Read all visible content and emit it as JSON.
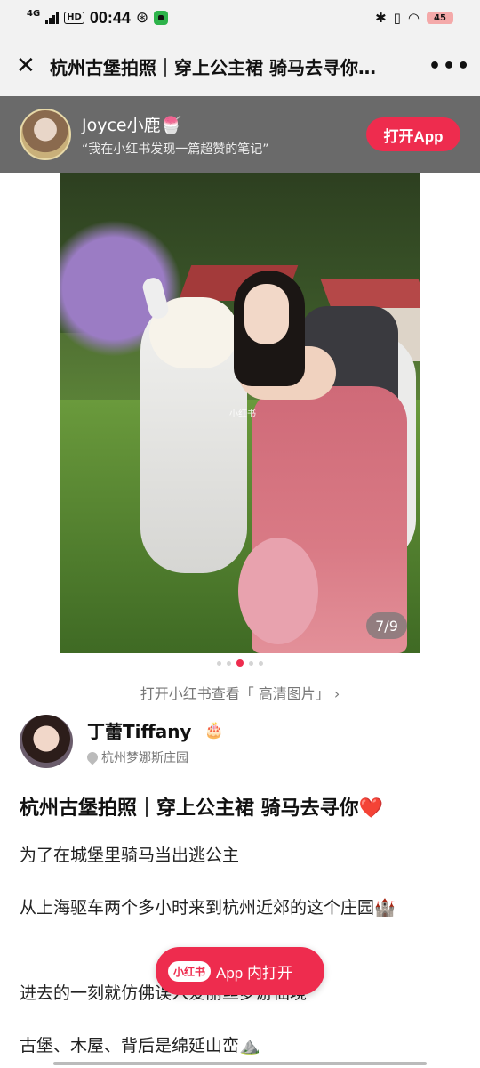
{
  "status_bar": {
    "network": "4G",
    "hd": "HD",
    "time": "00:44",
    "battery": "45"
  },
  "header": {
    "title": "杭州古堡拍照｜穿上公主裙 骑马去寻你…",
    "close_icon": "close-icon",
    "more": "•••"
  },
  "share_banner": {
    "sharer_name": "Joyce小鹿🍧",
    "quote": "“我在小红书发现一篇超赞的笔记”",
    "open_app_label": "打开App"
  },
  "photo": {
    "watermark": "小红书",
    "page_counter": "7/9",
    "current_index": 3,
    "total_dots": 5
  },
  "hd_link": "打开小红书查看「 高清图片」 ›",
  "author": {
    "name": "丁蕾Tiffany",
    "badge": "🎂",
    "location": "杭州梦娜斯庄园"
  },
  "note": {
    "title": "杭州古堡拍照｜穿上公主裙 骑马去寻你",
    "title_emoji": "❤️",
    "paragraphs": [
      "为了在城堡里骑马当出逃公主",
      "从上海驱车两个多小时来到杭州近郊的这个庄园🏰",
      "进去的一刻就仿佛误入爱丽丝梦游仙境",
      "古堡、木屋、背后是绵延山峦⛰️"
    ]
  },
  "floating_button": {
    "logo": "小红书",
    "label": "App 内打开"
  },
  "colors": {
    "brand_red": "#ee2c4e",
    "banner_bg": "#6a6a6a"
  }
}
